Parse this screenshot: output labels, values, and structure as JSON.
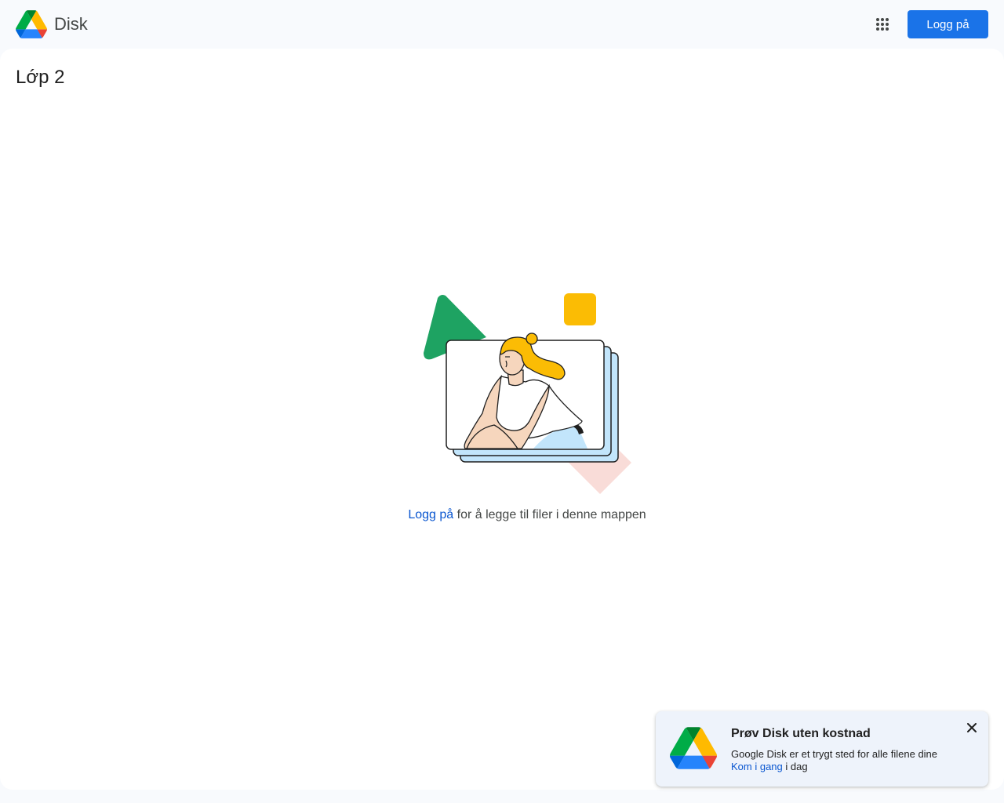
{
  "header": {
    "app_name": "Disk",
    "apps_icon": "apps-grid-icon",
    "signin_label": "Logg på"
  },
  "folder": {
    "title": "Lớp 2"
  },
  "empty_state": {
    "link_text": "Logg på",
    "message": " for å legge til filer i denne mappen"
  },
  "promo": {
    "title": "Prøv Disk uten kostnad",
    "description": "Google Disk er et trygt sted for alle filene dine",
    "cta_link": "Kom i gang",
    "cta_suffix": " i dag",
    "close_icon": "close-icon"
  },
  "colors": {
    "primary_button": "#1a73e8",
    "link": "#0b57d0",
    "drive_green": "#1ea362",
    "drive_yellow": "#fbbc04",
    "drive_blue": "#4285f4"
  }
}
